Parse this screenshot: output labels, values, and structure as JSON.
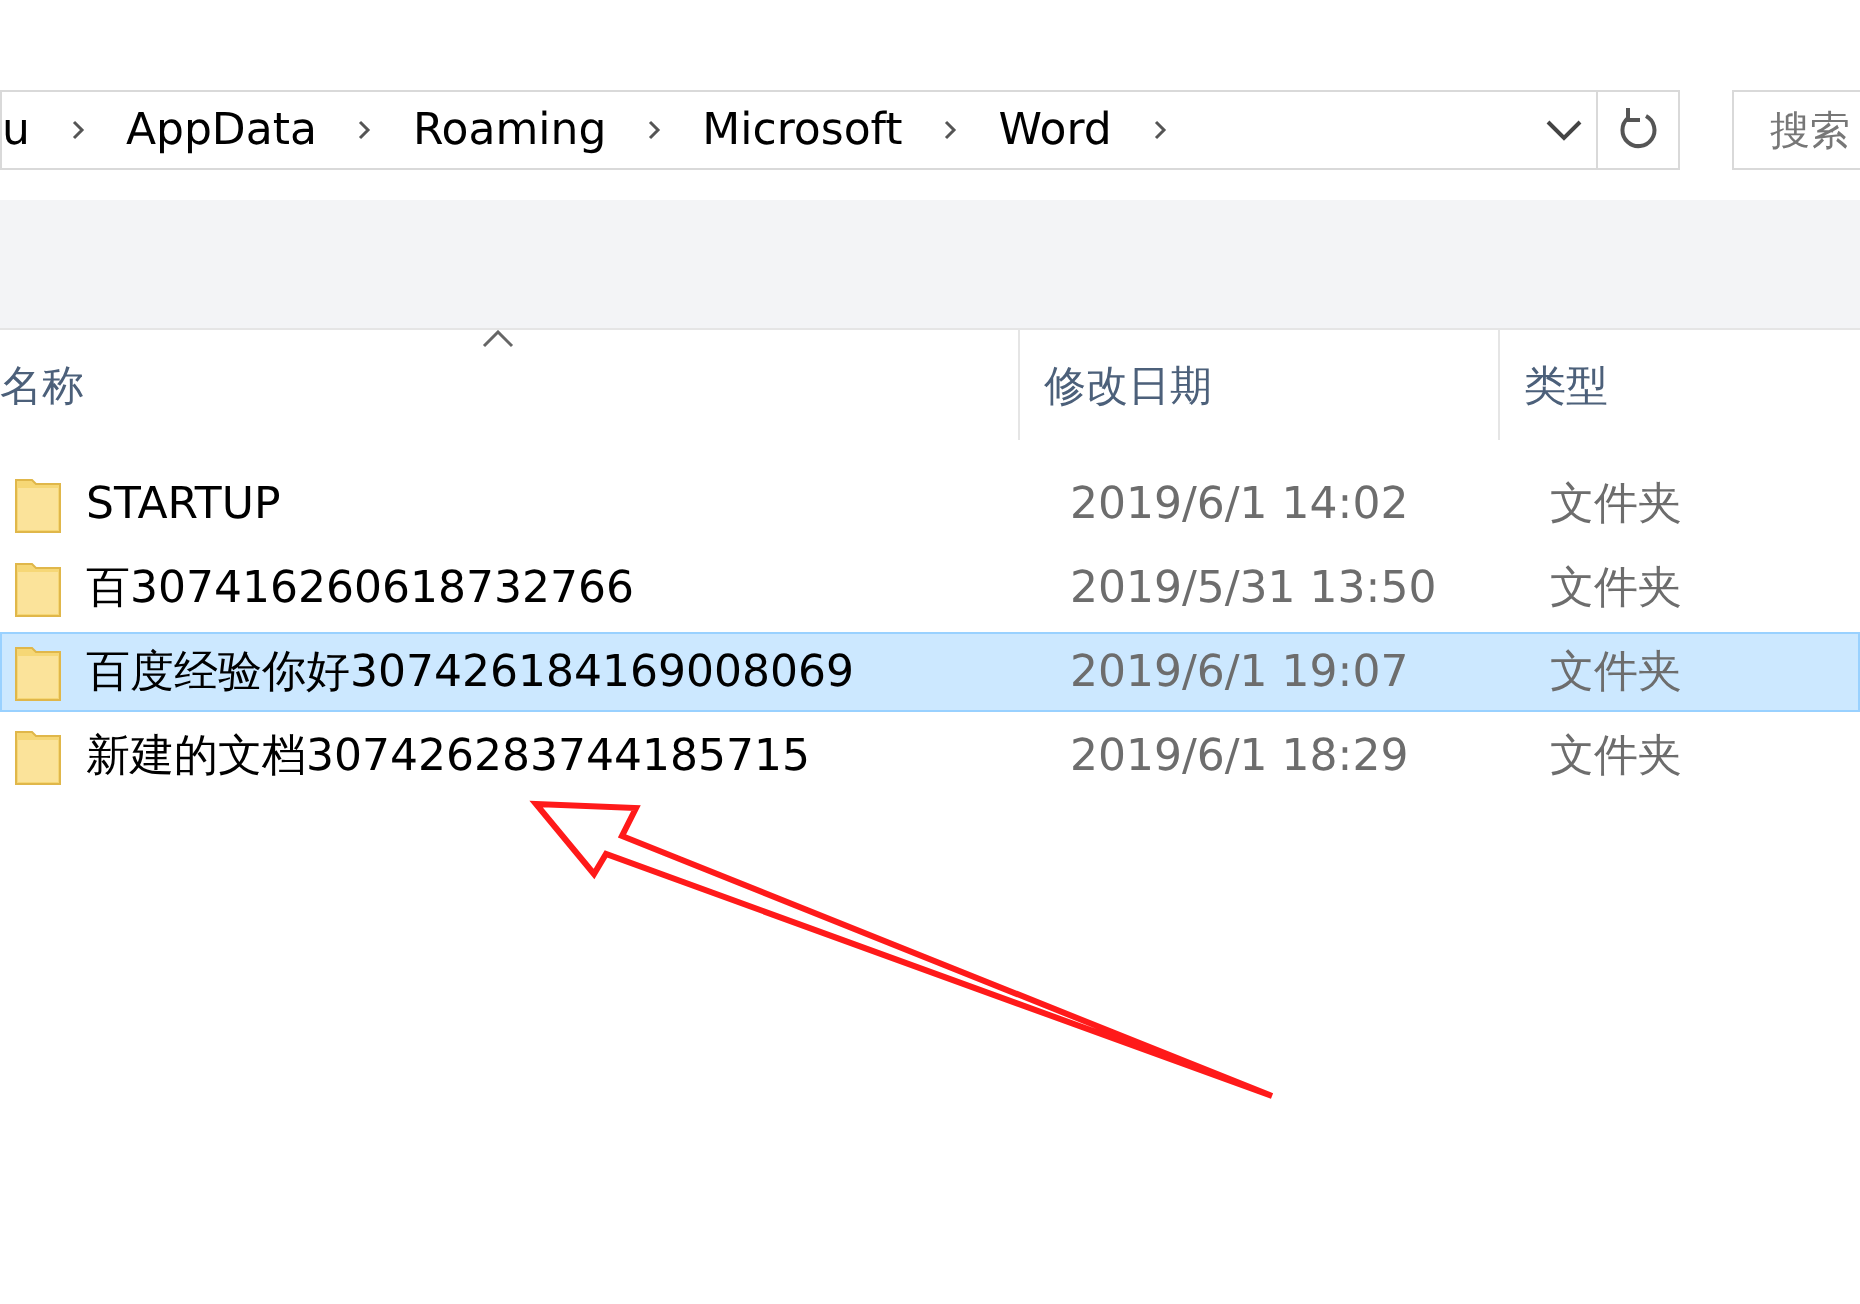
{
  "address_bar": {
    "crumbs": [
      "u",
      "AppData",
      "Roaming",
      "Microsoft",
      "Word"
    ]
  },
  "search": {
    "placeholder": "搜索"
  },
  "columns": [
    {
      "label": "名称",
      "sorted": true
    },
    {
      "label": "修改日期",
      "sorted": false
    },
    {
      "label": "类型",
      "sorted": false
    }
  ],
  "rows": [
    {
      "name": "STARTUP",
      "modified": "2019/6/1 14:02",
      "type": "文件夹",
      "selected": false
    },
    {
      "name": "百307416260618732766",
      "modified": "2019/5/31 13:50",
      "type": "文件夹",
      "selected": false
    },
    {
      "name": "百度经验你好307426184169008069",
      "modified": "2019/6/1 19:07",
      "type": "文件夹",
      "selected": true
    },
    {
      "name": "新建的文档307426283744185715",
      "modified": "2019/6/1 18:29",
      "type": "文件夹",
      "selected": false
    }
  ]
}
